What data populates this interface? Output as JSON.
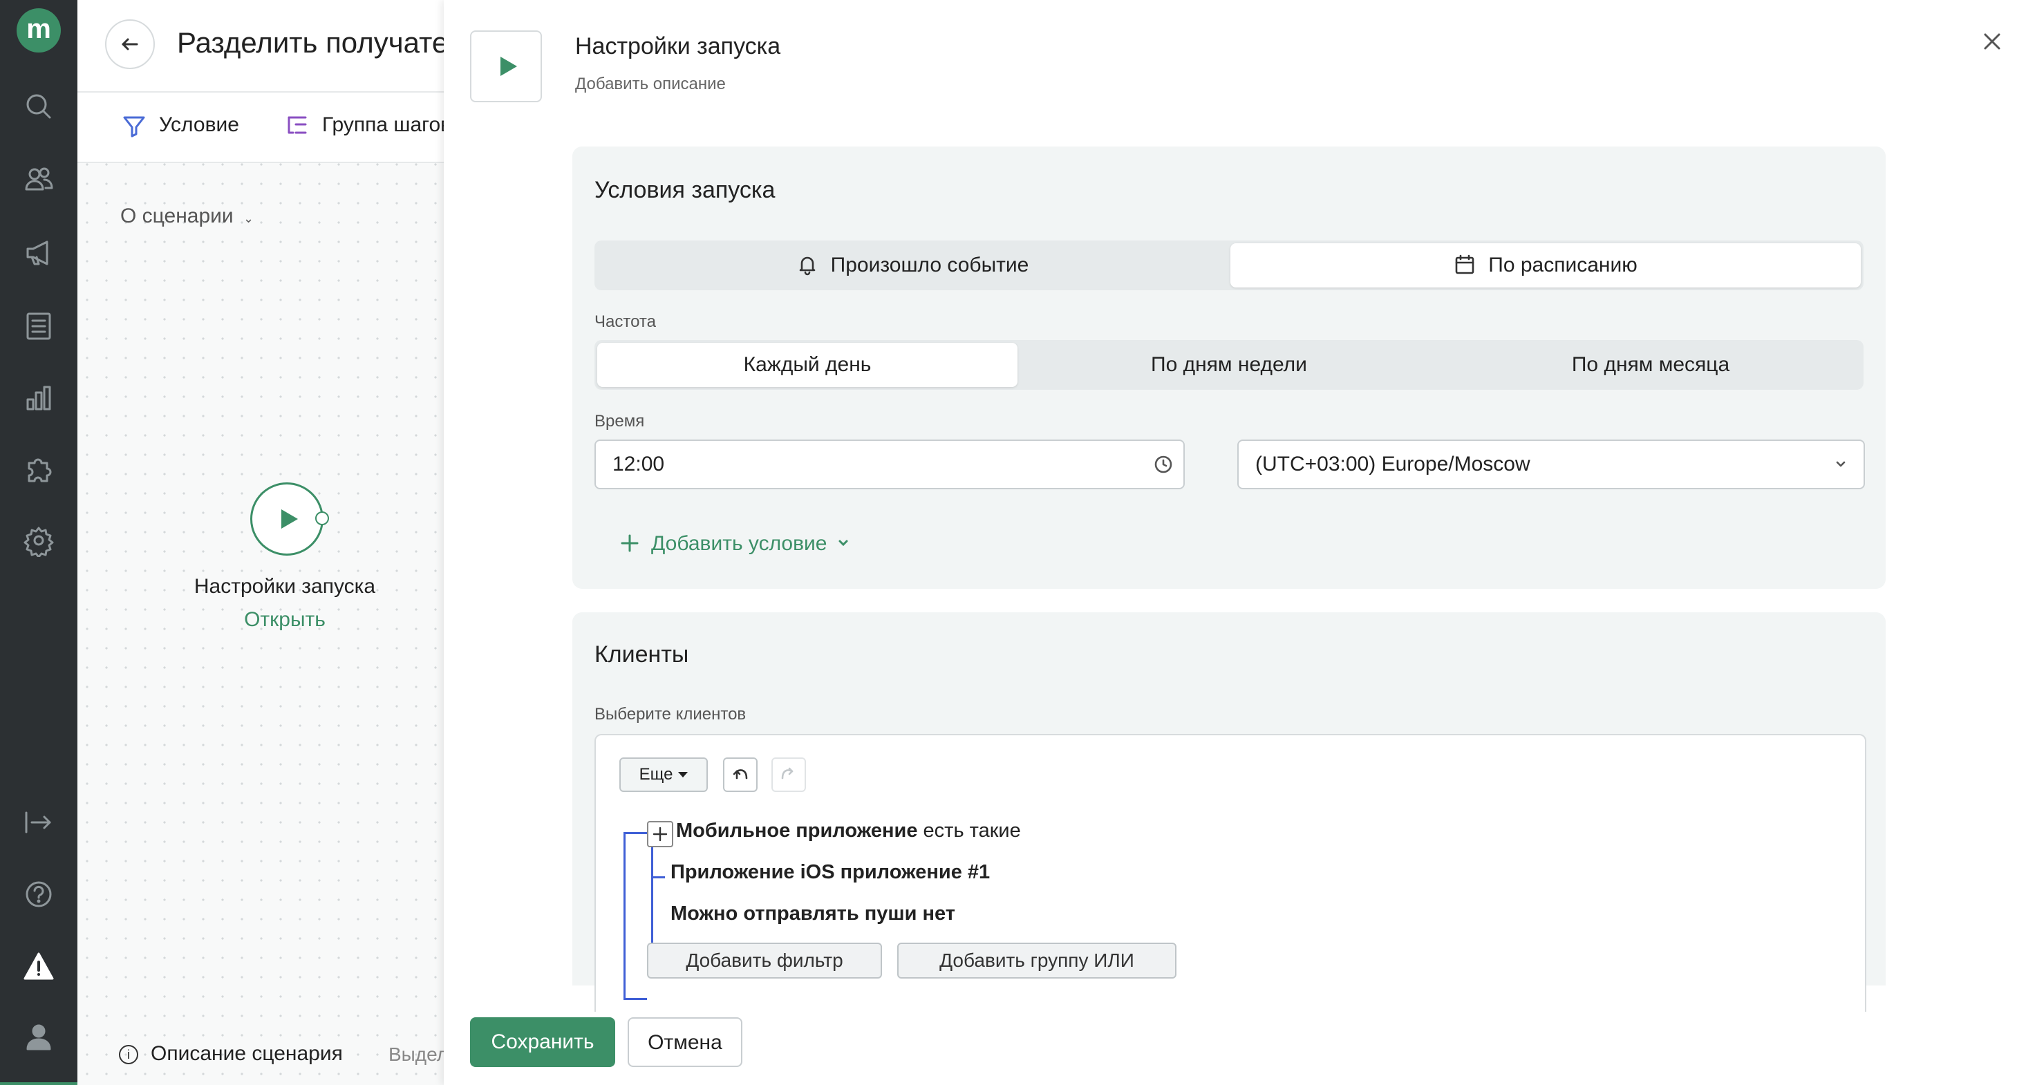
{
  "app": {
    "logo_letter": "m"
  },
  "builder": {
    "title": "Разделить получате",
    "tools": [
      {
        "label": "Условие"
      },
      {
        "label": "Группа шагов"
      }
    ],
    "about": "О сценарии",
    "node": {
      "title": "Настройки запуска",
      "link": "Открыть"
    },
    "footer": {
      "description": "Описание сценария",
      "select": "Выдел"
    }
  },
  "panel": {
    "title": "Настройки запуска",
    "description": "Добавить описание",
    "launch": {
      "heading": "Условия запуска",
      "trigger_options": [
        {
          "label": "Произошло событие",
          "icon": "bell-icon",
          "selected": false
        },
        {
          "label": "По расписанию",
          "icon": "calendar-icon",
          "selected": true
        }
      ],
      "frequency_label": "Частота",
      "frequency_options": [
        {
          "label": "Каждый день",
          "selected": true
        },
        {
          "label": "По дням недели",
          "selected": false
        },
        {
          "label": "По дням месяца",
          "selected": false
        }
      ],
      "time_label": "Время",
      "time_value": "12:00",
      "timezone": "(UTC+03:00) Europe/Moscow",
      "add_condition": "Добавить условие"
    },
    "clients": {
      "heading": "Клиенты",
      "select_label": "Выберите клиентов",
      "more_button": "Еще",
      "root_filter": {
        "bold": "Мобильное приложение",
        "rest": " есть такие"
      },
      "sub_filters": [
        "Приложение iOS приложение #1",
        "Можно отправлять пуши нет"
      ],
      "add_filter": "Добавить фильтр",
      "add_or_group": "Добавить группу ИЛИ"
    },
    "actions": {
      "save": "Сохранить",
      "cancel": "Отмена"
    }
  },
  "colors": {
    "accent": "#3c8f67",
    "rail": "#2c3033",
    "tree_line": "#3f5fd6"
  }
}
